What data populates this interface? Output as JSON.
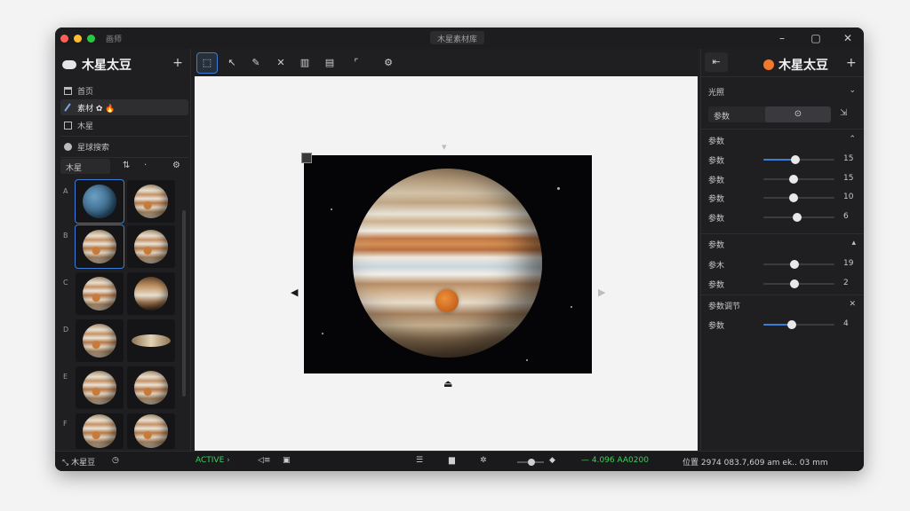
{
  "window": {
    "app_name": "画师",
    "doc_title": "木星素材库"
  },
  "left_panel": {
    "brand": "木星太豆",
    "add_label": "+",
    "nav": [
      {
        "label": "首页",
        "icon": "home-icon"
      },
      {
        "label": "素材 ✿ 🔥",
        "icon": "pen-icon",
        "active": true
      },
      {
        "label": "木星",
        "icon": "book-icon"
      },
      {
        "label": "星球搜索",
        "icon": "globe-icon"
      }
    ],
    "filter_label": "木星",
    "thumb_rows": [
      "A",
      "B",
      "C",
      "D",
      "E",
      "F"
    ]
  },
  "toolbar": {
    "tools": [
      "select-tool",
      "pointer-tool",
      "pen-tool",
      "crop-tool",
      "layers-tool",
      "document-tool",
      "frame-tool",
      "settings-tool"
    ]
  },
  "right_panel": {
    "brand": "木星太豆",
    "add_label": "+",
    "section_top": "光照",
    "segment_left": "参数",
    "section1": {
      "title": "参数",
      "sliders": [
        {
          "label": "参数",
          "value": "15",
          "level": 0.45,
          "filled": true
        },
        {
          "label": "参数",
          "value": "15",
          "level": 0.42,
          "filled": false
        },
        {
          "label": "参数",
          "value": "10",
          "level": 0.42,
          "filled": false
        },
        {
          "label": "参数",
          "value": "6",
          "level": 0.48,
          "filled": false
        }
      ]
    },
    "section2": {
      "title": "参数",
      "sliders": [
        {
          "label": "参木",
          "value": "19",
          "level": 0.44,
          "filled": false
        },
        {
          "label": "参数",
          "value": "2",
          "level": 0.44,
          "filled": false
        }
      ]
    },
    "section3": {
      "title": "参数调节",
      "sliders": [
        {
          "label": "参数",
          "value": "4",
          "level": 0.4,
          "filled": true
        }
      ]
    }
  },
  "status_bar": {
    "left_label": "木星豆",
    "status_text": "ACTIVE",
    "readout_green": "— 4.096  AA0200",
    "readout": "位置 2974 083.7,609 am ek.. 03 mm"
  },
  "colors": {
    "accent": "#3d7bd8",
    "status_green": "#3ad15a",
    "planet_spot": "#f07a2a"
  }
}
